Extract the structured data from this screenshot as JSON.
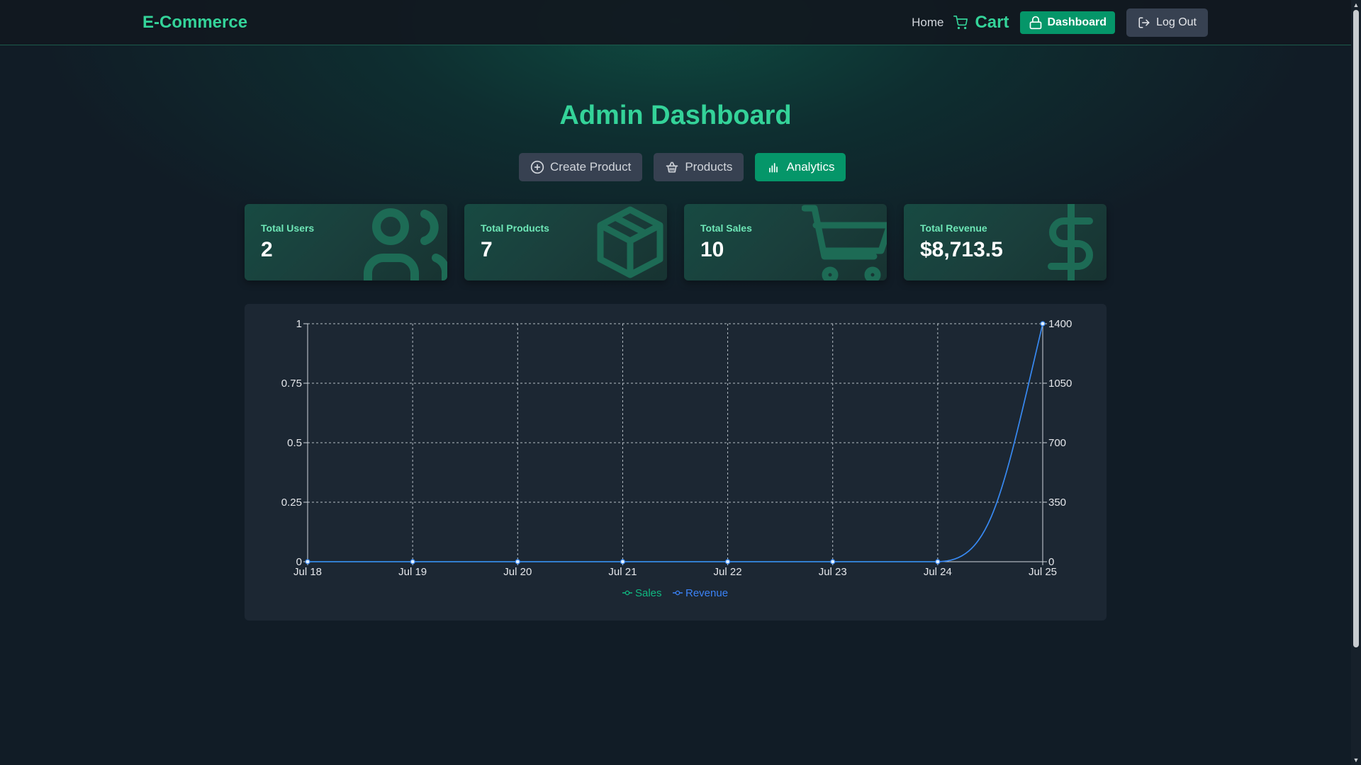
{
  "header": {
    "brand": "E-Commerce",
    "home": "Home",
    "cart": "Cart",
    "dashboard": "Dashboard",
    "logout": "Log Out"
  },
  "page_title": "Admin Dashboard",
  "tabs": [
    {
      "label": "Create Product",
      "icon": "plus-circle-icon",
      "active": false
    },
    {
      "label": "Products",
      "icon": "basket-icon",
      "active": false
    },
    {
      "label": "Analytics",
      "icon": "bar-chart-icon",
      "active": true
    }
  ],
  "stats": [
    {
      "label": "Total Users",
      "value": "2",
      "icon": "users-icon"
    },
    {
      "label": "Total Products",
      "value": "7",
      "icon": "package-icon"
    },
    {
      "label": "Total Sales",
      "value": "10",
      "icon": "shopping-cart-icon"
    },
    {
      "label": "Total Revenue",
      "value": "$8,713.5",
      "icon": "dollar-sign-icon"
    }
  ],
  "colors": {
    "accent": "#34d399",
    "sales": "#10b981",
    "revenue": "#3b82f6"
  },
  "chart_data": {
    "type": "line",
    "x": [
      "Jul 18",
      "Jul 19",
      "Jul 20",
      "Jul 21",
      "Jul 22",
      "Jul 23",
      "Jul 24",
      "Jul 25"
    ],
    "series": [
      {
        "name": "Sales",
        "axis": "left",
        "values": [
          0,
          0,
          0,
          0,
          0,
          0,
          0,
          1
        ]
      },
      {
        "name": "Revenue",
        "axis": "right",
        "values": [
          0,
          0,
          0,
          0,
          0,
          0,
          0,
          1400
        ]
      }
    ],
    "left_ticks": [
      "0",
      "0.25",
      "0.5",
      "0.75",
      "1"
    ],
    "right_ticks": [
      "0",
      "350",
      "700",
      "1050",
      "1400"
    ],
    "left_ylim": [
      0,
      1
    ],
    "right_ylim": [
      0,
      1400
    ],
    "grid": true,
    "legend": "bottom"
  }
}
